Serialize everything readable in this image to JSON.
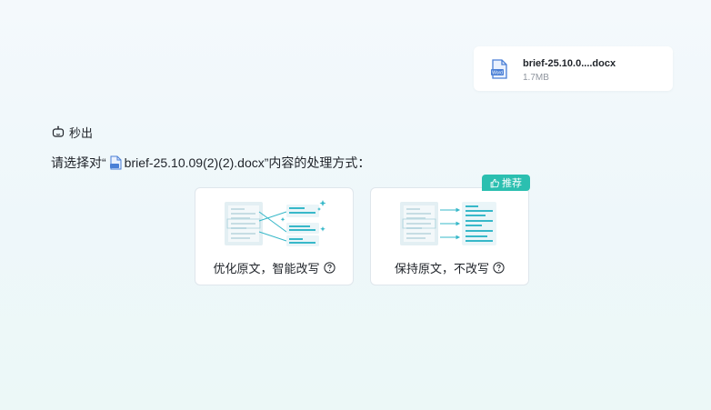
{
  "file": {
    "name": "brief-25.10.0....docx",
    "size": "1.7MB",
    "icon": "word-doc-icon",
    "icon_text": "Word"
  },
  "status": {
    "icon": "thinking-icon",
    "text": "秒出"
  },
  "prompt": {
    "before": "请选择对“",
    "file_icon": "word-doc-icon",
    "filename": "brief-25.10.09(2)(2).docx",
    "after": "”内容的处理方式："
  },
  "options": [
    {
      "label": "优化原文，智能改写",
      "help_icon": "question-circle-icon",
      "illustration": "rewrite-illustration"
    },
    {
      "label": "保持原文，不改写",
      "help_icon": "question-circle-icon",
      "illustration": "keep-original-illustration"
    }
  ],
  "badge": {
    "text": "推荐",
    "icon": "thumbs-up-icon"
  },
  "colors": {
    "accent": "#2bbfb0",
    "doc_blue": "#4a7fd6",
    "line_teal": "#37b8c9"
  }
}
